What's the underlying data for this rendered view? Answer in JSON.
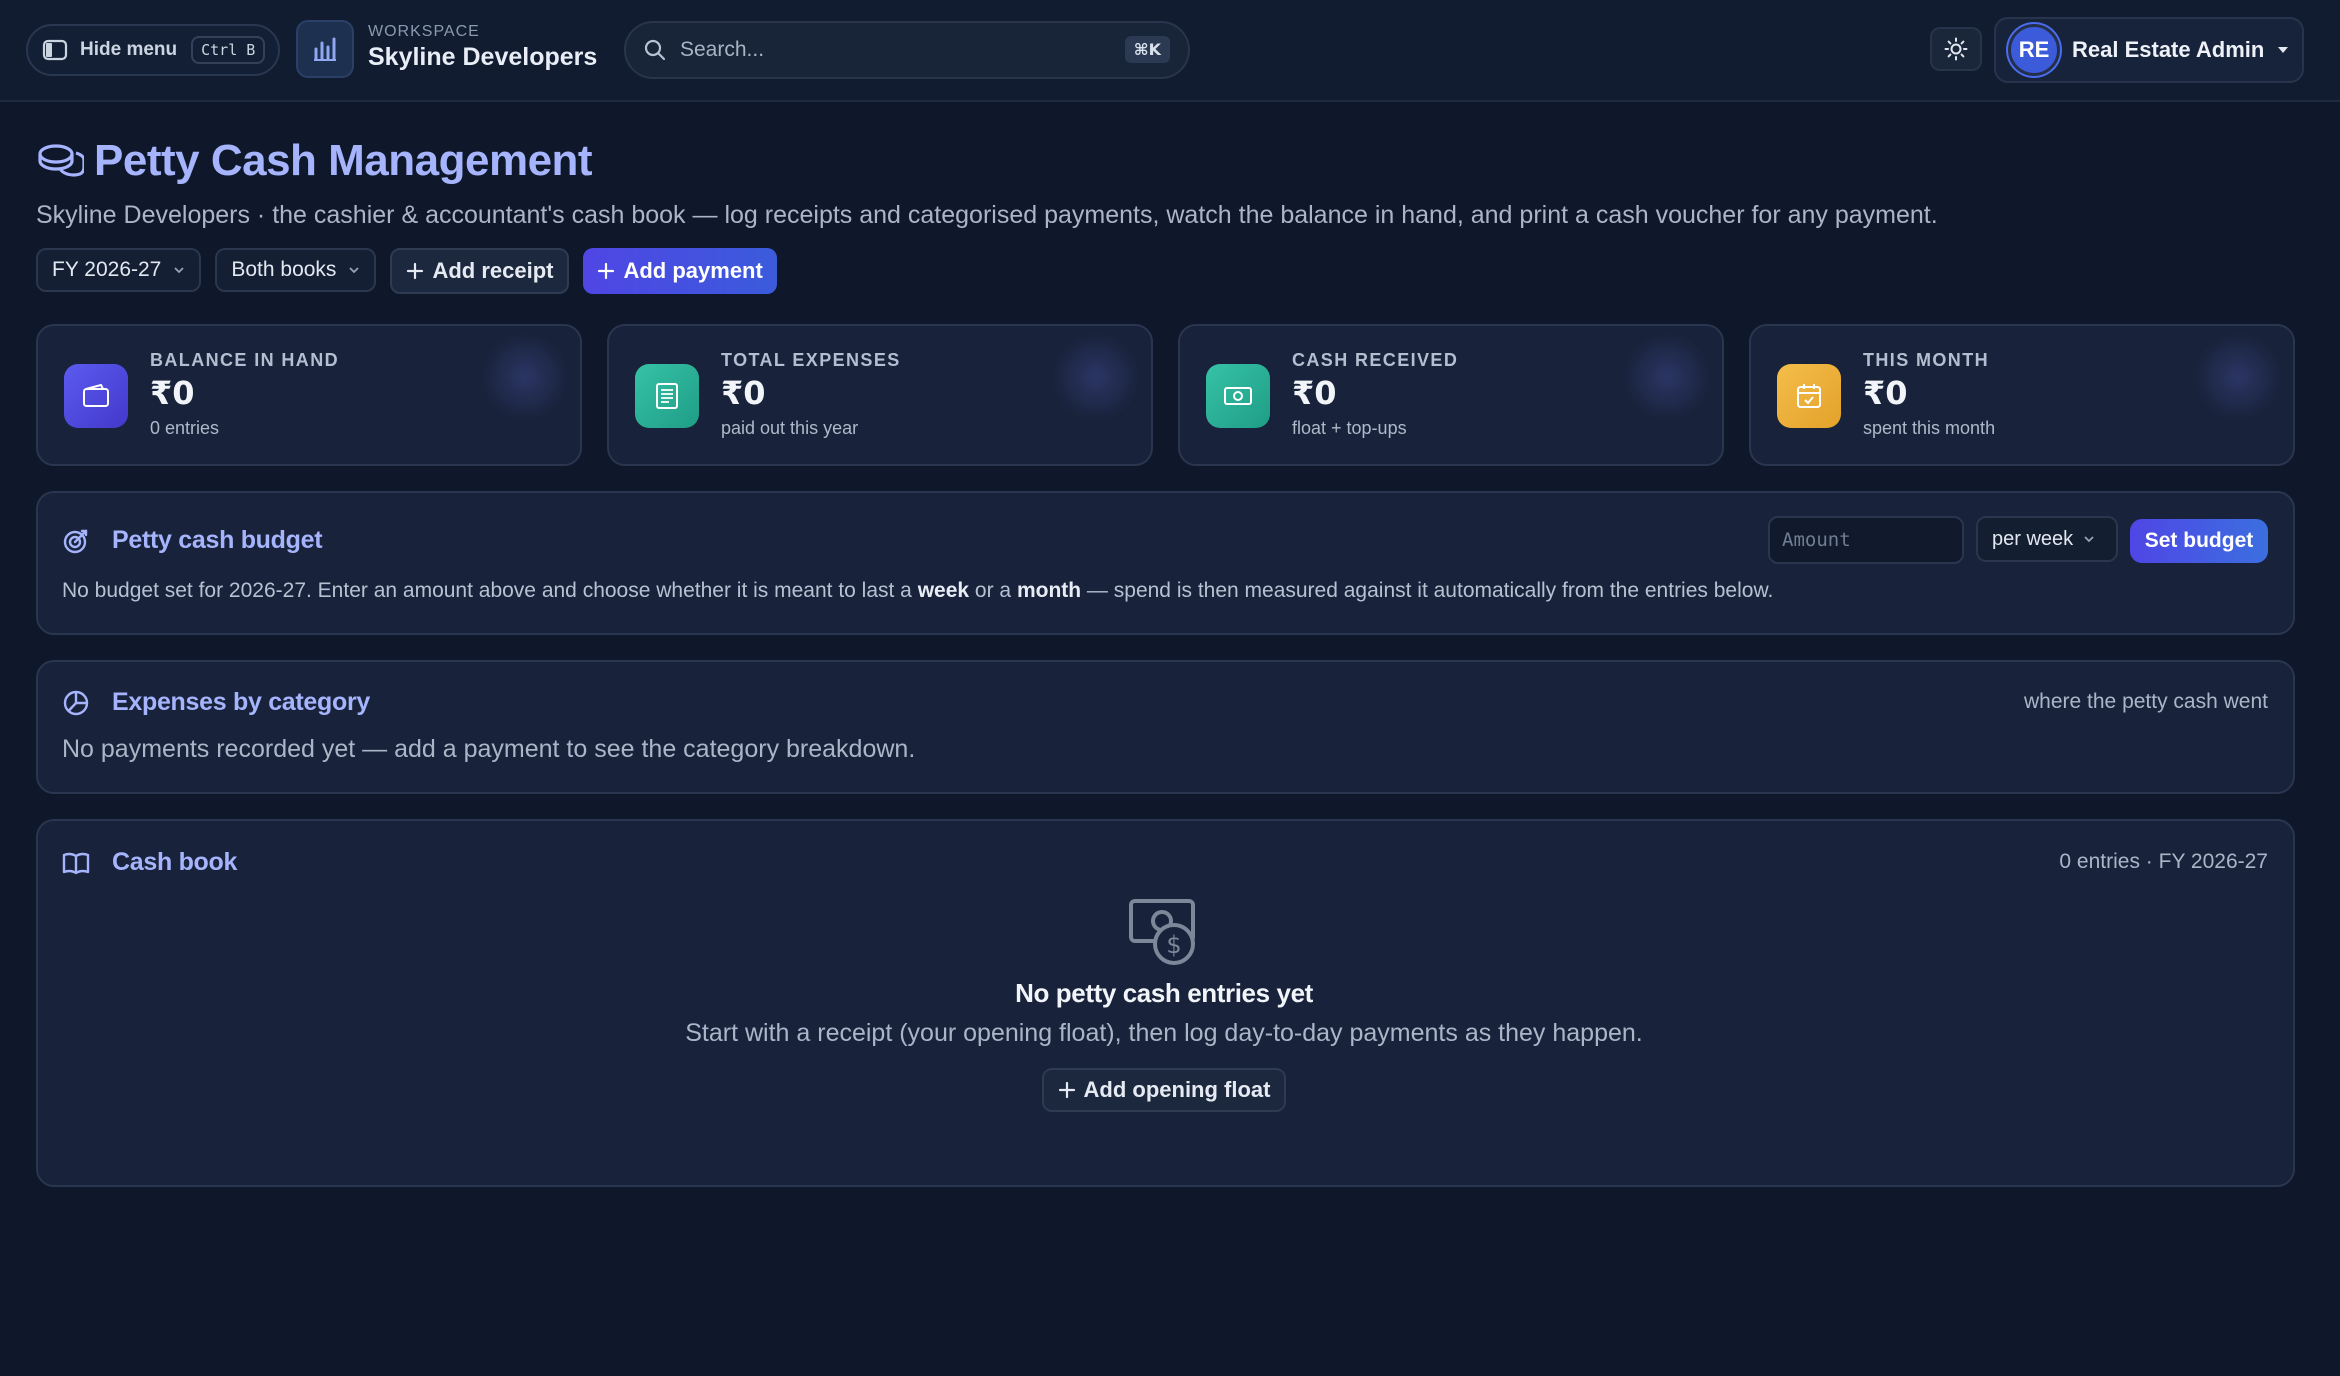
{
  "topbar": {
    "hide_menu_label": "Hide menu",
    "hide_menu_shortcut": "Ctrl B",
    "workspace_label": "WORKSPACE",
    "workspace_name": "Skyline Developers",
    "search_placeholder": "Search...",
    "search_shortcut": "⌘K",
    "user_initials": "RE",
    "user_name": "Real Estate Admin"
  },
  "page": {
    "title": "Petty Cash Management",
    "subtitle": "Skyline Developers · the cashier & accountant's cash book — log receipts and categorised payments, watch the balance in hand, and print a cash voucher for any payment.",
    "fy_select": "FY 2026-27",
    "book_select": "Both books",
    "add_receipt_label": "Add receipt",
    "add_payment_label": "Add payment"
  },
  "stats": [
    {
      "label": "BALANCE IN HAND",
      "value": "₹0",
      "sub": "0 entries",
      "icon": "wallet-icon",
      "color": "#4f46e5"
    },
    {
      "label": "TOTAL EXPENSES",
      "value": "₹0",
      "sub": "paid out this year",
      "icon": "receipt-icon",
      "color": "#2fb39a"
    },
    {
      "label": "CASH RECEIVED",
      "value": "₹0",
      "sub": "float + top-ups",
      "icon": "cash-icon",
      "color": "#2fb39a"
    },
    {
      "label": "THIS MONTH",
      "value": "₹0",
      "sub": "spent this month",
      "icon": "calendar-check-icon",
      "color": "#f0b43c"
    }
  ],
  "budget": {
    "title": "Petty cash budget",
    "amount_placeholder": "Amount",
    "period_select": "per week",
    "set_label": "Set budget",
    "text_before": "No budget set for 2026-27. Enter an amount above and choose whether it is meant to last a ",
    "text_week": "week",
    "text_or": " or a ",
    "text_month": "month",
    "text_after": " — spend is then measured against it automatically from the entries below."
  },
  "categories": {
    "title": "Expenses by category",
    "hint": "where the petty cash went",
    "empty": "No payments recorded yet — add a payment to see the category breakdown."
  },
  "cashbook": {
    "title": "Cash book",
    "meta": "0 entries · FY 2026-27",
    "empty_title": "No petty cash entries yet",
    "empty_text": "Start with a receipt (your opening float), then log day-to-day payments as they happen.",
    "opening_float_label": "Add opening float"
  },
  "colors": {
    "accent": "#a5b4fc",
    "primary_button": "#4f46e5",
    "background": "#0f172a"
  }
}
